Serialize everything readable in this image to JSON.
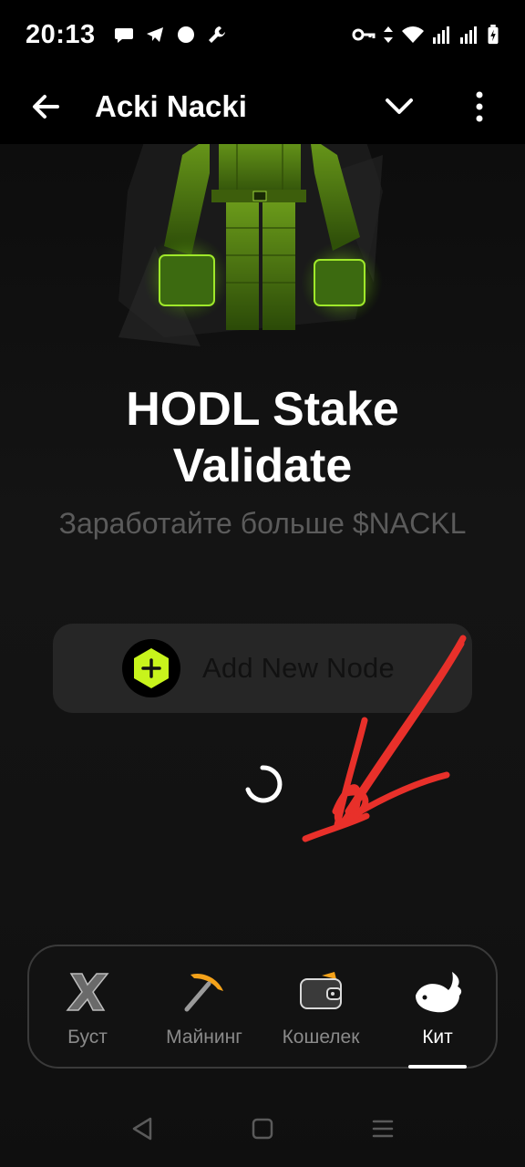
{
  "status_bar": {
    "time": "20:13",
    "left_icons": [
      "chat-bubble-icon",
      "telegram-icon",
      "dot-icon",
      "wrench-icon"
    ],
    "right_icons": [
      "key-icon",
      "data-arrows-icon",
      "wifi-icon",
      "signal-icon",
      "signal-icon",
      "battery-charging-icon"
    ]
  },
  "header": {
    "title": "Acki Nacki",
    "back_icon": "arrow-left-icon",
    "dropdown_icon": "chevron-down-icon",
    "menu_icon": "kebab-menu-icon"
  },
  "main": {
    "headline": "HODL Stake\nValidate",
    "headline_line1": "HODL Stake",
    "headline_line2": "Validate",
    "subheadline": "Заработайте больше $NACKL",
    "add_node_label": "Add New Node"
  },
  "bottom_nav": {
    "items": [
      {
        "label": "Буст",
        "icon": "x-boost-icon"
      },
      {
        "label": "Майнинг",
        "icon": "pickaxe-icon"
      },
      {
        "label": "Кошелек",
        "icon": "wallet-icon"
      },
      {
        "label": "Кит",
        "icon": "whale-icon"
      }
    ],
    "active_index": 3
  },
  "colors": {
    "accent": "#c8f41c",
    "scribble": "#e8302a",
    "background": "#0d0d0d"
  }
}
